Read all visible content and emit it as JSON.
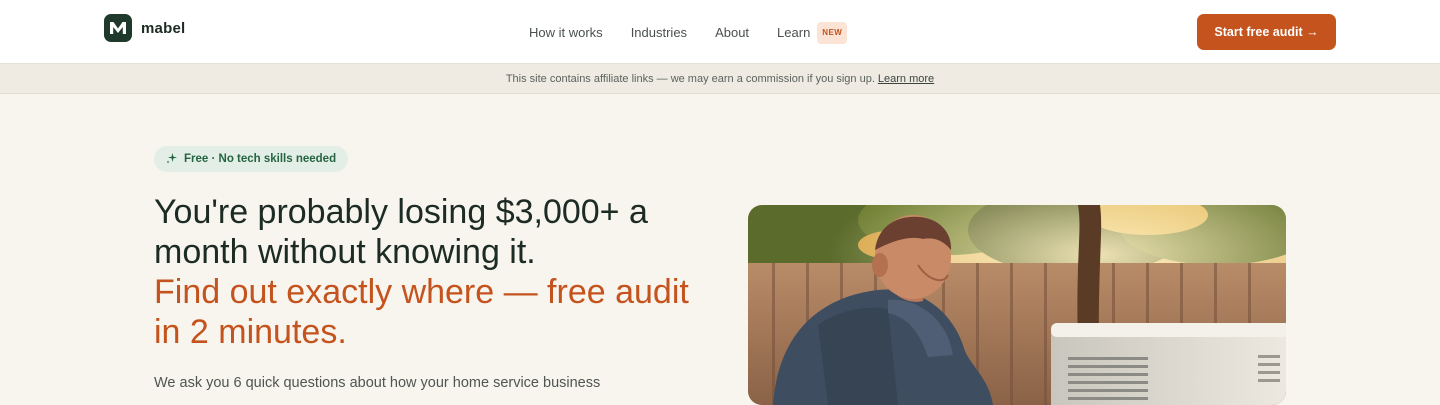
{
  "brand": {
    "name": "mabel",
    "logo_letter": "M",
    "logo_color": "#1f3a2d"
  },
  "nav": {
    "links": [
      "How it works",
      "Industries",
      "About",
      "Learn"
    ],
    "learn_badge": "NEW",
    "cta_label": "Start free audit →"
  },
  "affiliate": {
    "text": "This site contains affiliate links — we may earn a commission if you sign up.",
    "link_label": "Learn more"
  },
  "hero": {
    "pill_text": "Free · No tech skills needed",
    "headline_line1": "You're probably losing $3,000+ a",
    "headline_line2": "month without knowing it.",
    "accent_line1": "Find out exactly where — free audit",
    "accent_line2": "in 2 minutes.",
    "intro": "We ask you 6 quick questions about how your home service business",
    "image_icon": "hvac-technician-photo"
  },
  "colors": {
    "accent": "#c4531d",
    "dark": "#1c2b23",
    "pill_bg": "#e3efe6",
    "pill_text": "#256443",
    "page_bg": "#f8f5ef"
  }
}
